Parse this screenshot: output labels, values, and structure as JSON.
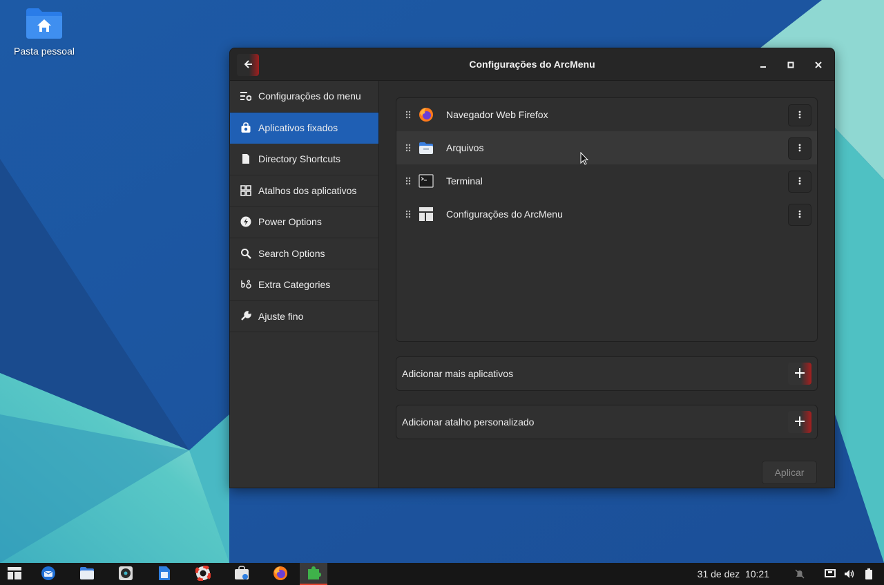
{
  "desktop": {
    "home_folder_label": "Pasta pessoal"
  },
  "window": {
    "title": "Configurações do ArcMenu",
    "controls": [
      "minimize-icon",
      "maximize-icon",
      "close-icon"
    ]
  },
  "sidebar": {
    "items": [
      {
        "label": "Configurações do menu",
        "icon": "menu-settings-icon",
        "active": false
      },
      {
        "label": "Aplicativos fixados",
        "icon": "pinned-apps-icon",
        "active": true
      },
      {
        "label": "Directory Shortcuts",
        "icon": "document-icon",
        "active": false
      },
      {
        "label": "Atalhos dos aplicativos",
        "icon": "grid-icon",
        "active": false
      },
      {
        "label": "Power Options",
        "icon": "power-icon",
        "active": false
      },
      {
        "label": "Search Options",
        "icon": "search-icon",
        "active": false
      },
      {
        "label": "Extra Categories",
        "icon": "categories-icon",
        "active": false
      },
      {
        "label": "Ajuste fino",
        "icon": "wrench-icon",
        "active": false
      }
    ]
  },
  "pinned_apps": [
    {
      "name": "Navegador Web Firefox",
      "icon": "firefox-icon"
    },
    {
      "name": "Arquivos",
      "icon": "files-icon"
    },
    {
      "name": "Terminal",
      "icon": "terminal-icon"
    },
    {
      "name": "Configurações do ArcMenu",
      "icon": "arcmenu-settings-icon"
    }
  ],
  "actions": {
    "add_apps": "Adicionar mais aplicativos",
    "add_shortcut": "Adicionar atalho personalizado",
    "apply": "Aplicar"
  },
  "taskbar": {
    "apps": [
      "arcmenu-icon",
      "thunderbird-icon",
      "files-icon",
      "rhythmbox-icon",
      "libreoffice-writer-icon",
      "help-icon",
      "software-icon",
      "firefox-icon",
      "extensions-icon"
    ],
    "active_app": "extensions-icon",
    "date": "31 de dez",
    "time": "10:21",
    "tray": [
      "notifications-muted-icon",
      "network-icon",
      "volume-icon",
      "battery-icon"
    ]
  },
  "colors": {
    "accent": "#1f5fb4",
    "accent_red": "#a81f1f",
    "window_bg": "#2c2c2c"
  }
}
